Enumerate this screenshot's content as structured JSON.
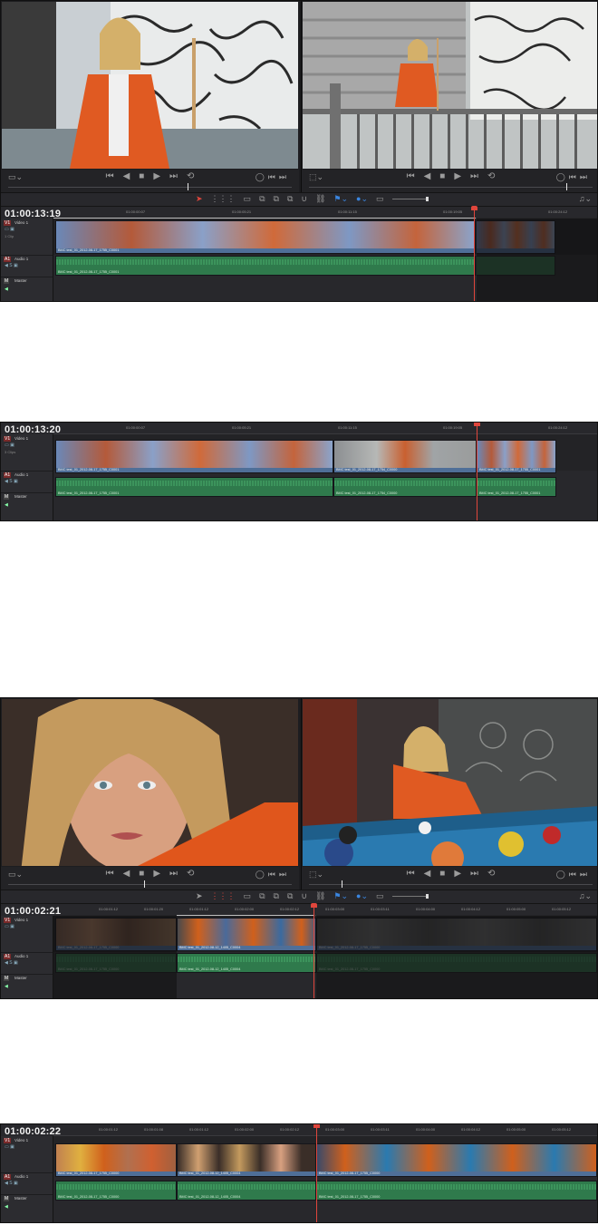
{
  "panel1": {
    "timecode": "01:00:13:19",
    "ruler": [
      "01:00:00:07",
      "01:00:05:21",
      "01:00:11:15",
      "01:00:19:05",
      "01:00:24:12"
    ],
    "tracks": {
      "v1_badge": "V1",
      "v1_name": "Video 1",
      "v1_sub": "1 Clip",
      "a1_badge": "A1",
      "a1_name": "Audio 1",
      "m_badge": "M",
      "m_name": "Master"
    },
    "video_clips": [
      "BMC test_01_2012-08-17_1755_C0001"
    ],
    "audio_clips": [
      "BMC test_01_2012-08-17_1755_C0001"
    ]
  },
  "panel2": {
    "timecode": "01:00:13:20",
    "ruler": [
      "01:00:00:07",
      "01:00:05:21",
      "01:00:11:15",
      "01:00:19:05",
      "01:00:24:12"
    ],
    "tracks": {
      "v1_badge": "V1",
      "v1_name": "Video 1",
      "v1_sub": "3 Clips",
      "a1_badge": "A1",
      "a1_name": "Audio 1",
      "m_badge": "M",
      "m_name": "Master"
    },
    "video_clips": [
      "BMC test_01_2012-08-17_1755_C0001",
      "BMC test_01_2012-08-17_1754_C0000",
      "BMC test_01_2012-08-17_1755_C0001"
    ],
    "audio_clips": [
      "BMC test_01_2012-08-17_1755_C0001",
      "BMC test_01_2012-08-17_1754_C0000",
      "BMC test_01_2012-08-17_1755_C0001"
    ]
  },
  "panel3": {
    "timecode": "01:00:02:21",
    "ruler": [
      "01:00:01:12",
      "01:00:01:20",
      "01:00:01:12",
      "01:00:02:00",
      "01:00:02:12",
      "01:00:03:00",
      "01:00:03:11",
      "01:00:04:00",
      "01:00:04:12",
      "01:00:05:00",
      "01:00:05:12"
    ],
    "tracks": {
      "v1_badge": "V1",
      "v1_name": "Video 1",
      "v1_sub": "",
      "a1_badge": "A1",
      "a1_name": "Audio 1",
      "m_badge": "M",
      "m_name": "Master"
    },
    "video_clips": [
      "BMC test_01_2012-08-17_1755_C0000",
      "BMC test_01_2012-08-12_1405_C0004",
      "BMC test_01_2012-08-17_1755_C0000"
    ],
    "audio_clips": [
      "BMC test_01_2012-08-17_1755_C0000",
      "BMC test_01_2012-08-12_1405_C0004",
      "BMC test_01_2012-08-17_1755_C0000"
    ]
  },
  "panel4": {
    "timecode": "01:00:02:22",
    "ruler": [
      "01:00:01:12",
      "01:00:01:08",
      "01:00:01:12",
      "01:00:02:00",
      "01:00:02:12",
      "01:00:03:00",
      "01:00:03:11",
      "01:00:04:00",
      "01:00:04:12",
      "01:00:05:00",
      "01:00:05:12"
    ],
    "tracks": {
      "v1_badge": "V1",
      "v1_name": "Video 1",
      "v1_sub": "",
      "a1_badge": "A1",
      "a1_name": "Audio 1",
      "m_badge": "M",
      "m_name": "Master"
    },
    "video_clips": [
      "BMC test_01_2012-08-17_1755_C0000",
      "BMC test_01_2012-08-12_1405_C0004",
      "BMC test_01_2012-08-17_1755_C0000"
    ],
    "audio_clips": [
      "BMC test_01_2012-08-17_1755_C0000",
      "BMC test_01_2012-08-12_1405_C0004",
      "BMC test_01_2012-08-17_1755_C0000"
    ]
  },
  "icons": {
    "transport": [
      "skip-back-icon",
      "step-back-icon",
      "stop-icon",
      "play-icon",
      "skip-forward-icon",
      "loop-icon"
    ],
    "viewer_left": [
      "clip-view-icon"
    ],
    "viewer_right": [
      "in-icon",
      "prev-frame-icon",
      "next-frame-icon"
    ]
  },
  "colors": {
    "accent_red": "#e0463c",
    "accent_blue": "#3a86e0",
    "video_clip": "#4f6f98",
    "audio_clip": "#2f7a4c",
    "panel": "#28282c"
  }
}
